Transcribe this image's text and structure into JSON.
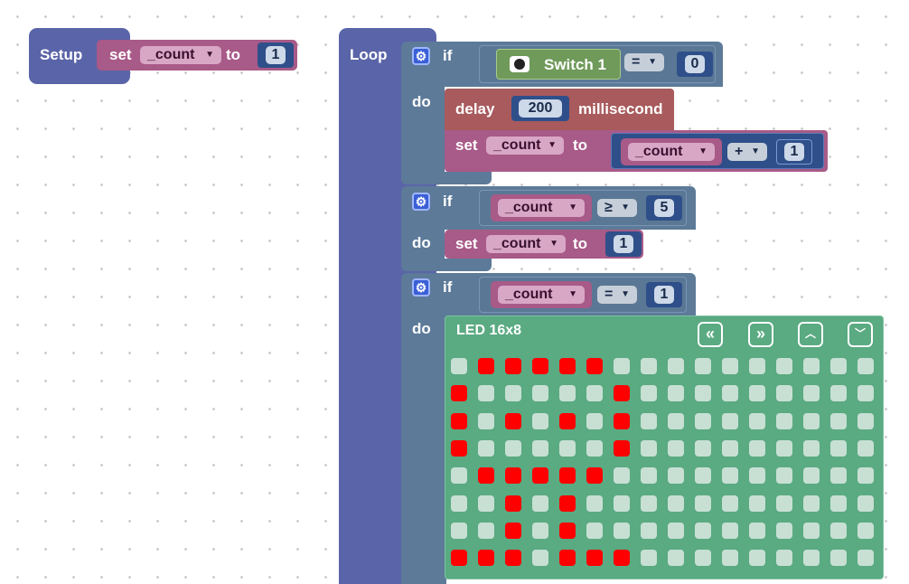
{
  "setup": {
    "hat_label": "Setup",
    "set_label": "set",
    "variable": "_count",
    "to_label": "to",
    "value": "1"
  },
  "loop": {
    "hat_label": "Loop",
    "if1": {
      "if_label": "if",
      "do_label": "do",
      "switch_label": "Switch 1",
      "operator": "=",
      "compare_value": "0",
      "delay_label": "delay",
      "delay_value": "200",
      "delay_unit": "millisecond",
      "set_label": "set",
      "set_variable": "_count",
      "to_label": "to",
      "math_variable": "_count",
      "math_operator": "+",
      "math_value": "1"
    },
    "if2": {
      "if_label": "if",
      "do_label": "do",
      "variable": "_count",
      "operator": "≥",
      "compare_value": "5",
      "set_label": "set",
      "set_variable": "_count",
      "to_label": "to",
      "set_value": "1"
    },
    "if3": {
      "if_label": "if",
      "do_label": "do",
      "variable": "_count",
      "operator": "=",
      "compare_value": "1"
    }
  },
  "led_block": {
    "title": "LED 16x8",
    "nav_buttons": [
      "«",
      "»",
      "⌃⌃",
      "⌄⌄"
    ],
    "on_color": "#ff0000",
    "off_color": "#c8e0d4",
    "matrix": [
      "0111110000000000",
      "1000001000000000",
      "1010101000000000",
      "1000001000000000",
      "0111110000000000",
      "0010100000000000",
      "0010100000000000",
      "1110111000000000"
    ]
  },
  "colors": {
    "hat": "#5a64a8",
    "control": "#5d7a99",
    "variable_set": "#a85a88",
    "delay": "#a85a5c",
    "led_block": "#5aaa82"
  }
}
